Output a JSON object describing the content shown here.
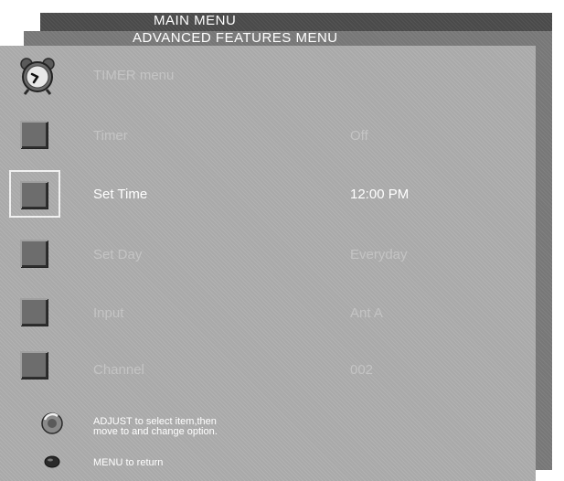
{
  "menus": {
    "main_title": "MAIN MENU",
    "advanced_title": "ADVANCED FEATURES MENU"
  },
  "timer_menu": {
    "title": "TIMER menu",
    "rows": [
      {
        "label": "Timer",
        "value": "Off"
      },
      {
        "label": "Set Time",
        "value": "12:00 PM"
      },
      {
        "label": "Set Day",
        "value": "Everyday"
      },
      {
        "label": "Input",
        "value": "Ant A"
      },
      {
        "label": "Channel",
        "value": "002"
      }
    ],
    "selected_row": "Set Time"
  },
  "help": {
    "adjust_line1": "ADJUST to select item,then",
    "adjust_line2": "move to and change option.",
    "menu_return": "MENU to return"
  },
  "colors": {
    "background_main": "#4a4a4a",
    "background_advanced": "#777777",
    "background_timer": "#a9a9a9",
    "text_active": "#ffffff",
    "text_inactive": "#c4c4c4"
  },
  "icons": [
    "alarm-clock-icon",
    "adjust-knob-icon",
    "menu-button-icon"
  ]
}
